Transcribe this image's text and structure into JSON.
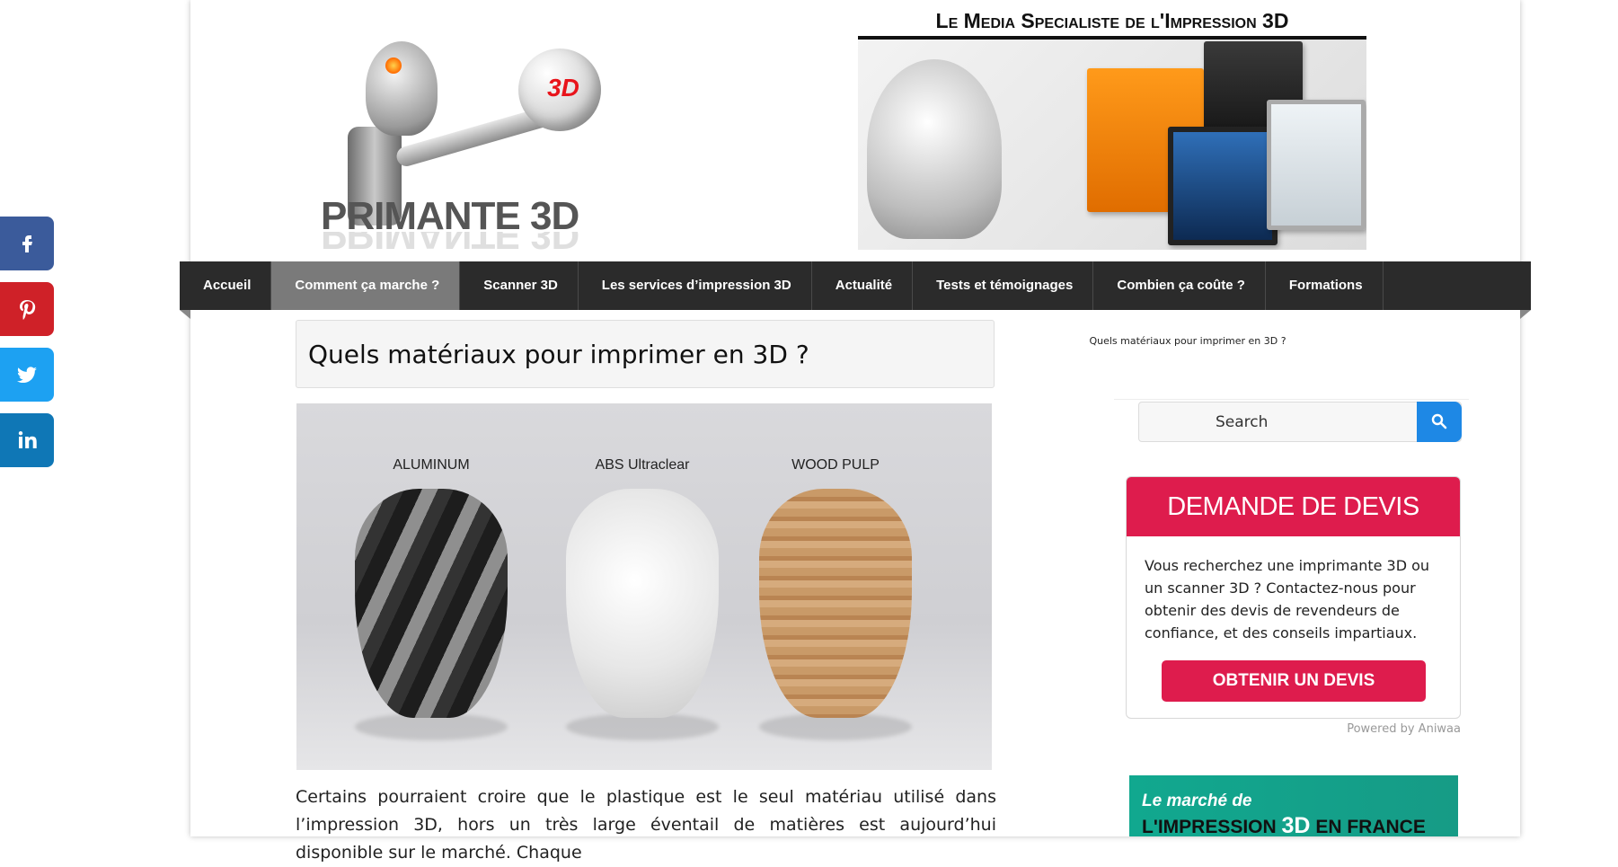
{
  "header": {
    "logo_text": "PRIMANTE 3D",
    "logo_orb_text": "3D",
    "banner_tagline": "Le Media Specialiste de l'Impression 3D"
  },
  "nav": {
    "items": [
      {
        "label": "Accueil"
      },
      {
        "label": "Comment ça marche ?",
        "active": true
      },
      {
        "label": "Scanner 3D"
      },
      {
        "label": "Les services d’impression 3D"
      },
      {
        "label": "Actualité"
      },
      {
        "label": "Tests et témoignages"
      },
      {
        "label": "Combien ça coûte ?"
      },
      {
        "label": "Formations"
      }
    ]
  },
  "article": {
    "title": "Quels matériaux pour imprimer en 3D ?",
    "image_captions": [
      "ALUMINUM",
      "ABS Ultraclear",
      "WOOD PULP"
    ],
    "body": "Certains pourraient croire que le plastique est le seul matériau utilisé dans l’impression 3D, hors un très large éventail de matières est aujourd’hui disponible sur le marché. Chaque"
  },
  "sidebar": {
    "breadcrumb": "Quels matériaux pour imprimer en 3D ?",
    "search_placeholder": "Search",
    "quote": {
      "heading": "DEMANDE DE DEVIS",
      "text": "Vous recherchez une imprimante 3D ou un scanner 3D ? Contactez-nous pour obtenir des devis de revendeurs de confiance, et des conseils impartiaux.",
      "button": "OBTENIR UN DEVIS",
      "powered": "Powered by Aniwaa"
    },
    "promo": {
      "line1": "Le marché de",
      "line2_prefix": "L'IMPRESSION",
      "line2_highlight": "3D",
      "line2_suffix": "EN FRANCE"
    }
  },
  "social": [
    "facebook-icon",
    "pinterest-icon",
    "twitter-icon",
    "linkedin-icon"
  ],
  "colors": {
    "nav_bg": "#2b2b2b",
    "nav_active": "#7a7a7a",
    "quote_accent": "#de1c4d",
    "search_button": "#1e88e5",
    "facebook": "#3b5b9b",
    "pinterest": "#cf2128",
    "twitter": "#1da1f2",
    "linkedin": "#0f77b6",
    "promo": "#11a88f"
  }
}
